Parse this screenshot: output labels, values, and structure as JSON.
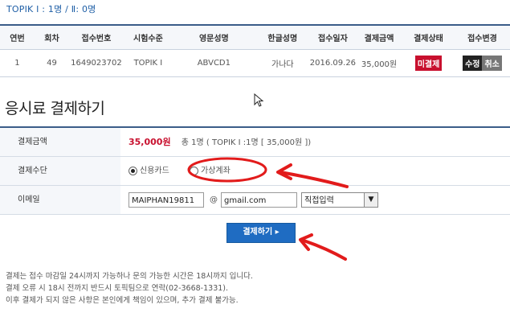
{
  "summary": "TOPIK Ⅰ : 1명 / Ⅱ: 0명",
  "table": {
    "headers": [
      "연번",
      "회차",
      "접수번호",
      "시험수준",
      "영문성명",
      "한글성명",
      "접수일자",
      "결제금액",
      "결제상태",
      "접수변경"
    ],
    "row": {
      "no": "1",
      "round": "49",
      "receipt": "1649023702",
      "level": "TOPIK Ⅰ",
      "name_en": "ABVCD1",
      "name_ko": "가나다",
      "date": "2016.09.26",
      "amount": "35,000원",
      "status": "미결제",
      "edit_label": "수정",
      "cancel_label": "취소"
    }
  },
  "section_title": "응시료 결제하기",
  "payment": {
    "amount_label": "결제금액",
    "amount_value": "35,000원",
    "amount_detail": "총 1명 ( TOPIK Ⅰ :1명 [ 35,000원 ])",
    "method_label": "결제수단",
    "method_card": "신용카드",
    "method_account": "가상계좌",
    "email_label": "이메일",
    "email_user": "MAIPHAN19811",
    "email_at": "@",
    "email_domain": "gmail.com",
    "email_select": "직접입력",
    "pay_button": "결제하기 ▸"
  },
  "notes": [
    "결제는 접수 마감일 24시까지 가능하나 문의 가능한 시간은 18시까지 입니다.",
    "결제 오류 시 18시 전까지 반드시 토픽팀으로 연락(02-3668-1331).",
    "이후 결제가 되지 않은 사항은 본인에게 책임이 있으며, 추가 결제 불가능."
  ],
  "colors": {
    "accent": "#1f6cc2",
    "status_red": "#c8102e",
    "annotation": "#e21b1b"
  }
}
